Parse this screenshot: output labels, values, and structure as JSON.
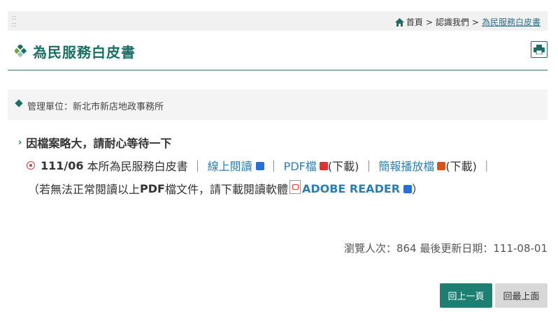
{
  "breadcrumb": {
    "home": "首頁",
    "sep1": ">",
    "level2": "認識我們",
    "sep2": ">",
    "current": "為民服務白皮書"
  },
  "page": {
    "title": "為民服務白皮書"
  },
  "unit": {
    "label": "管理單位：新北市新店地政事務所"
  },
  "content": {
    "notice": "因檔案略大，請耐心等待一下",
    "item": {
      "date": "111/06",
      "title": "本所為民服務白皮書",
      "pipe1": "｜",
      "online_label": "線上閱讀",
      "pipe2": "｜",
      "pdf_label": "PDF檔",
      "pdf_download": "(下載)",
      "pipe3": "｜",
      "slides_label": "簡報播放檔",
      "slides_download": "(下載)",
      "pipe4": "｜"
    },
    "reader": {
      "prefix": "（若無法正常閱讀以上",
      "pdf_word": "PDF",
      "middle": "檔文件，請下載閱讀軟體",
      "adobe_label": "ADOBE READER",
      "suffix": "）"
    }
  },
  "stats": {
    "text": "瀏覽人次：864  最後更新日期：111-08-01"
  },
  "buttons": {
    "back": "回上一頁",
    "top": "回最上面"
  },
  "colors": {
    "brand": "#1c6e64",
    "link": "#2a7fb0"
  }
}
